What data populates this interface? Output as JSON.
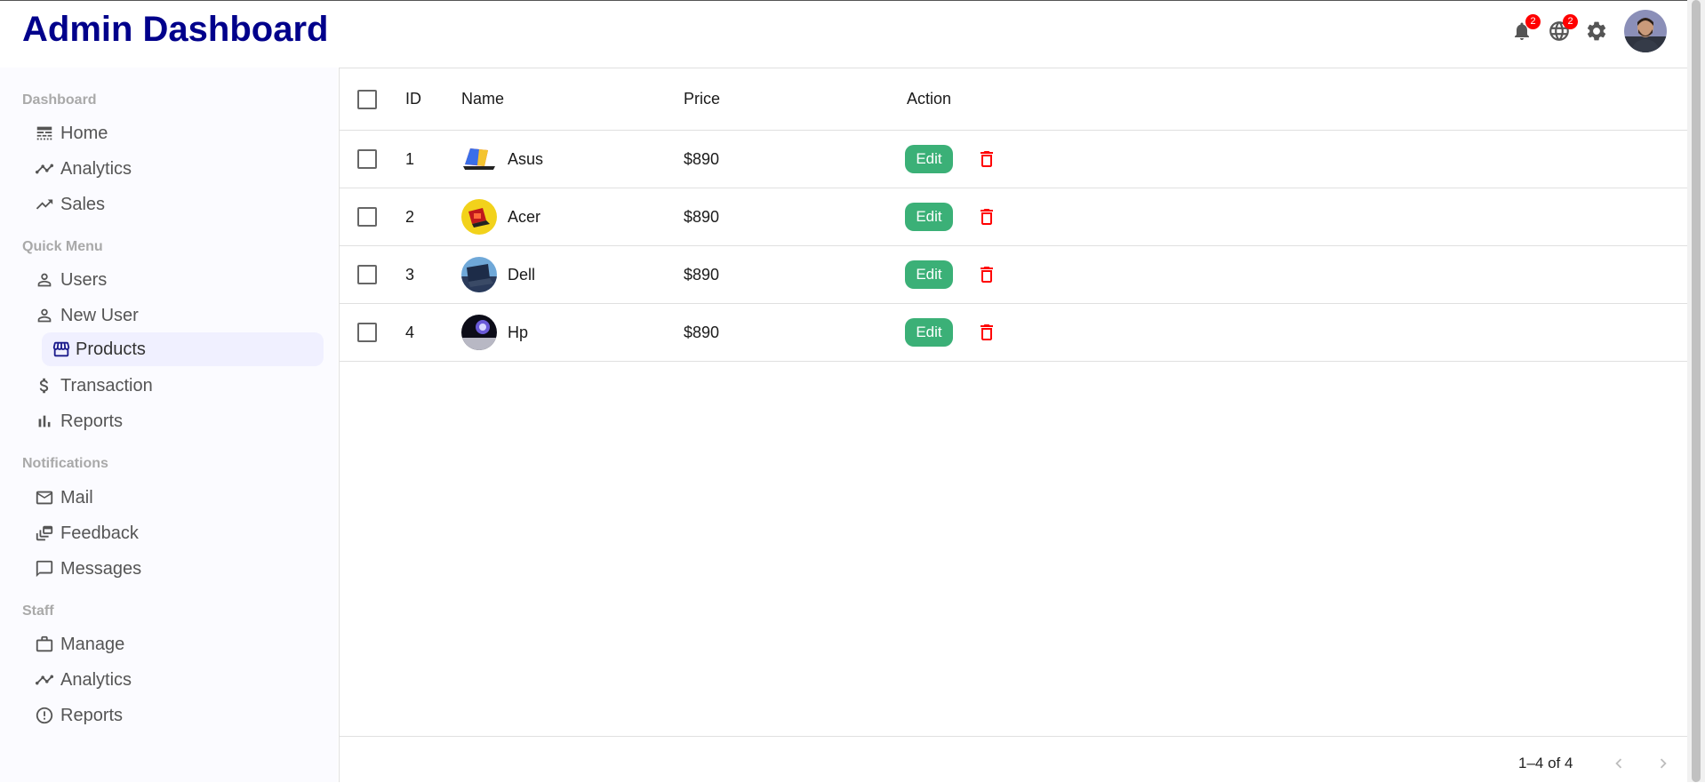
{
  "header": {
    "title": "Admin Dashboard",
    "notifications_badge": "2",
    "language_badge": "2",
    "icons": [
      "bell-icon",
      "globe-icon",
      "gear-icon",
      "avatar"
    ]
  },
  "sidebar": {
    "sections": [
      {
        "title": "Dashboard",
        "items": [
          {
            "label": "Home",
            "icon": "line-style-icon"
          },
          {
            "label": "Analytics",
            "icon": "timeline-icon"
          },
          {
            "label": "Sales",
            "icon": "trending-up-icon"
          }
        ]
      },
      {
        "title": "Quick Menu",
        "items": [
          {
            "label": "Users",
            "icon": "person-icon"
          },
          {
            "label": "New User",
            "icon": "person-icon"
          },
          {
            "label": "Products",
            "icon": "storefront-icon",
            "active": true
          },
          {
            "label": "Transaction",
            "icon": "dollar-icon"
          },
          {
            "label": "Reports",
            "icon": "bar-chart-icon"
          }
        ]
      },
      {
        "title": "Notifications",
        "items": [
          {
            "label": "Mail",
            "icon": "mail-icon"
          },
          {
            "label": "Feedback",
            "icon": "dynamic-feed-icon"
          },
          {
            "label": "Messages",
            "icon": "chat-bubble-icon"
          }
        ]
      },
      {
        "title": "Staff",
        "items": [
          {
            "label": "Manage",
            "icon": "briefcase-icon"
          },
          {
            "label": "Analytics",
            "icon": "timeline-icon"
          },
          {
            "label": "Reports",
            "icon": "error-outline-icon"
          }
        ]
      }
    ]
  },
  "table": {
    "columns": [
      "ID",
      "Name",
      "Price",
      "Action"
    ],
    "rows": [
      {
        "id": "1",
        "name": "Asus",
        "price": "$890",
        "edit": "Edit"
      },
      {
        "id": "2",
        "name": "Acer",
        "price": "$890",
        "edit": "Edit"
      },
      {
        "id": "3",
        "name": "Dell",
        "price": "$890",
        "edit": "Edit"
      },
      {
        "id": "4",
        "name": "Hp",
        "price": "$890",
        "edit": "Edit"
      }
    ],
    "pagination": "1–4 of 4"
  },
  "colors": {
    "brand": "#00008b",
    "edit_button": "#3bb077",
    "delete_icon": "#ff0000",
    "badge": "#ff0000",
    "active_item_bg": "#f0f0ff"
  }
}
